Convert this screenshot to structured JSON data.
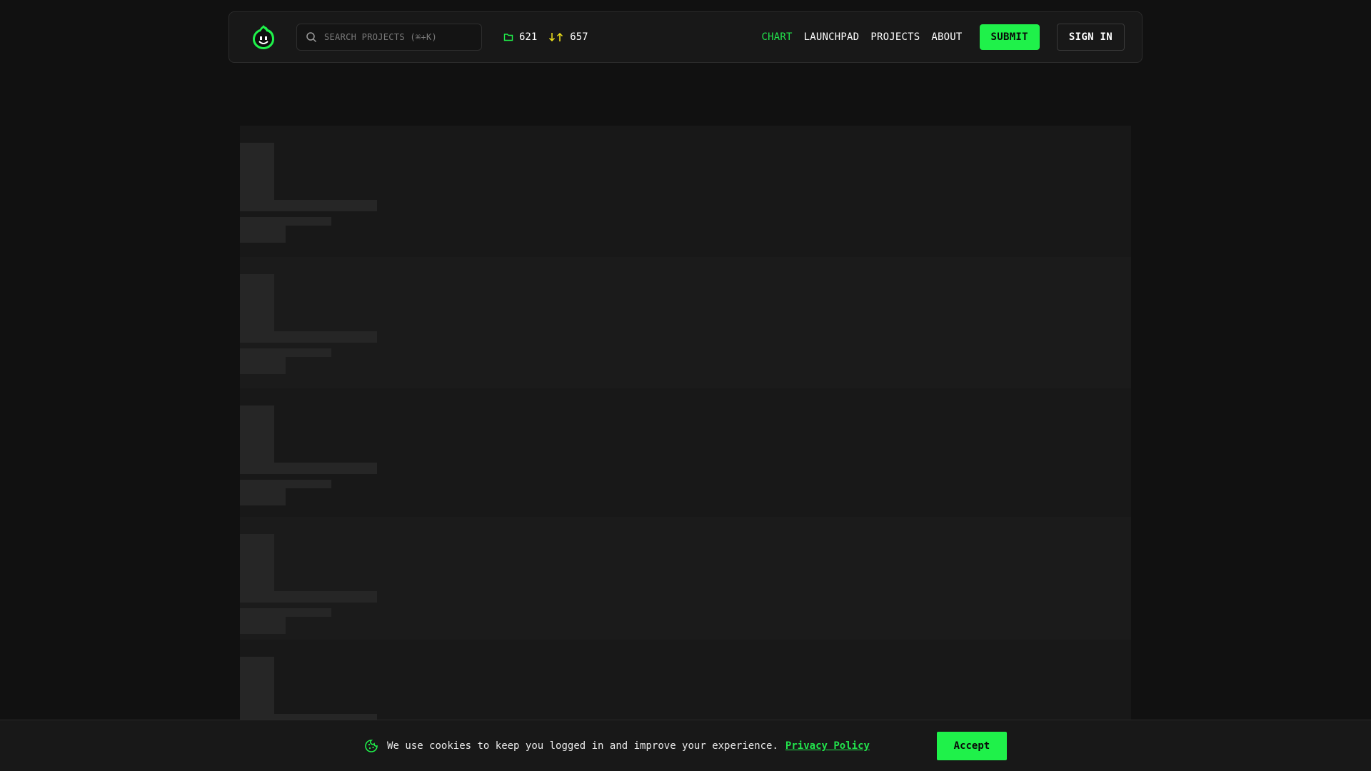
{
  "header": {
    "logo_icon": "smiley-flame-logo-icon",
    "search": {
      "placeholder": "SEARCH PROJECTS (⌘+K)",
      "icon": "search-icon"
    },
    "stats": {
      "projects_count": "621",
      "projects_icon": "folder-icon",
      "votes_count": "657",
      "votes_icon": "up-down-arrows-icon"
    },
    "nav": [
      {
        "label": "CHART",
        "active": true
      },
      {
        "label": "LAUNCHPAD",
        "active": false
      },
      {
        "label": "PROJECTS",
        "active": false
      },
      {
        "label": "ABOUT",
        "active": false
      }
    ],
    "submit_label": "SUBMIT",
    "signin_label": "SIGN IN"
  },
  "colors": {
    "accent": "#1ff14a",
    "background": "#111111",
    "surface": "#181818",
    "skeleton": "#262626"
  },
  "cookie_banner": {
    "icon": "cookie-icon",
    "message": "We use cookies to keep you logged in and improve your experience.",
    "link_label": "Privacy Policy",
    "accept_label": "Accept"
  }
}
